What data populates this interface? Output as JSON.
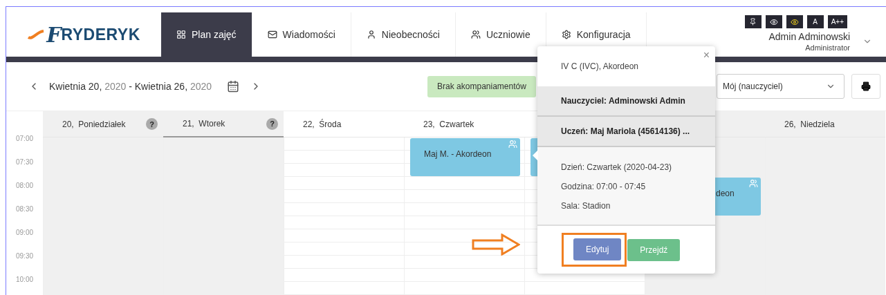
{
  "logo": {
    "initial": "F",
    "rest": "RYDERYK"
  },
  "nav": [
    {
      "label": "Plan zajęć",
      "selected": true
    },
    {
      "label": "Wiadomości",
      "selected": false
    },
    {
      "label": "Nieobecności",
      "selected": false
    },
    {
      "label": "Uczniowie",
      "selected": false
    },
    {
      "label": "Konfiguracja",
      "selected": false
    }
  ],
  "access_buttons": [
    {
      "kind": "pin"
    },
    {
      "kind": "eye"
    },
    {
      "kind": "eye-yellow"
    },
    {
      "kind": "text",
      "label": "A"
    },
    {
      "kind": "text",
      "label": "A++"
    }
  ],
  "user": {
    "name": "Admin Adminowski",
    "role": "Administrator"
  },
  "week": {
    "from": "Kwietnia 20,",
    "from_year": "2020",
    "separator": "-",
    "to": "Kwietnia 26,",
    "to_year": "2020"
  },
  "accompaniment_button": "Brak akompaniamentów",
  "teacher_select": {
    "value": "Mój (nauczyciel)"
  },
  "days": [
    {
      "label": "20,  Poniedziałek",
      "help": "?",
      "shaded": true,
      "selected": false
    },
    {
      "label": "21,  Wtorek",
      "help": "?",
      "shaded": true,
      "selected": true
    },
    {
      "label": "22,  Środa",
      "shaded": false,
      "selected": false
    },
    {
      "label": "23,  Czwartek",
      "shaded": false,
      "selected": false,
      "events": [
        {
          "kind": "full",
          "text": "Maj M. - Akordeon"
        }
      ]
    },
    {
      "shaded": false,
      "selected": false,
      "events": [
        {
          "kind": "covered"
        }
      ]
    },
    {
      "shaded": true,
      "selected": false,
      "events": [
        {
          "kind": "partial",
          "text": "deon"
        }
      ]
    },
    {
      "label": "26,  Niedziela",
      "shaded": true,
      "selected": false
    }
  ],
  "times": [
    "07:00",
    "07:30",
    "08:00",
    "08:30",
    "09:00",
    "09:30",
    "10:00"
  ],
  "popup": {
    "title": "IV C (IVC), Akordeon",
    "close": "×",
    "teacher": "Nauczyciel: Adminowski Admin",
    "student": "Uczeń: Maj Mariola (45614136) ...",
    "details": [
      "Dzień: Czwartek (2020-04-23)",
      "Godzina: 07:00 - 07:45",
      "Sala: Stadion"
    ],
    "buttons": [
      {
        "label": "Edytuj",
        "kind": "primary",
        "highlighted": true
      },
      {
        "label": "Przejdź",
        "kind": "success",
        "highlighted": false
      }
    ]
  }
}
